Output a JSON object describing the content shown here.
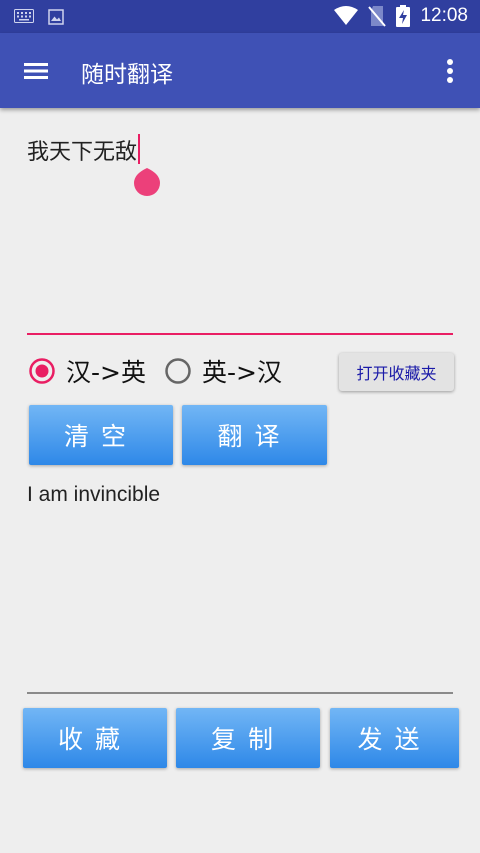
{
  "status_bar": {
    "time": "12:08",
    "icons": [
      "keyboard-icon",
      "image-icon",
      "wifi-icon",
      "no-sim-icon",
      "battery-charging-icon"
    ]
  },
  "app_bar": {
    "title": "随时翻译",
    "background_color": "#3f51b5",
    "status_color": "#303f9f"
  },
  "input": {
    "value": "我天下无敌",
    "accent_color": "#e91e63"
  },
  "direction": {
    "options": [
      {
        "label": "汉->英",
        "selected": true
      },
      {
        "label": "英->汉",
        "selected": false
      }
    ]
  },
  "favorites_button": "打开收藏夹",
  "buttons": {
    "clear": "清空",
    "translate": "翻译",
    "collect": "收藏",
    "copy": "复制",
    "send": "发送"
  },
  "output": {
    "value": "I am invincible"
  }
}
